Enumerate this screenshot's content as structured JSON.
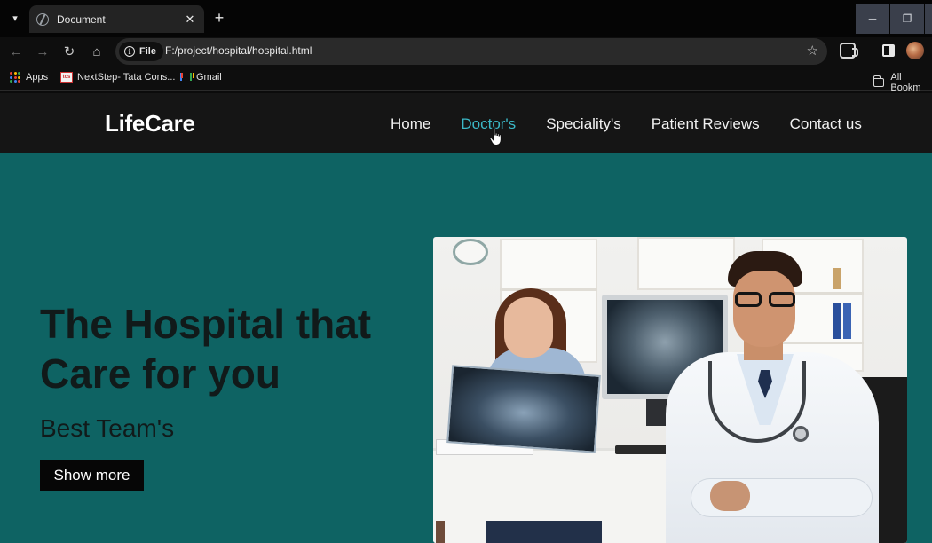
{
  "browser": {
    "tab_title": "Document",
    "tab_close": "✕",
    "new_tab": "+",
    "url_scheme_label": "File",
    "url": "F:/project/hospital/hospital.html",
    "window_min": "─",
    "window_restore": "❐"
  },
  "bookmarks": {
    "items": [
      {
        "label": "Apps",
        "icon": "apps-grid-icon"
      },
      {
        "label": "NextStep- Tata Cons...",
        "icon": "tcs-favicon"
      },
      {
        "label": "Gmail",
        "icon": "gmail-icon"
      }
    ],
    "all_bookmarks": "All Bookm"
  },
  "site": {
    "logo": "LifeCare",
    "nav": [
      {
        "label": "Home"
      },
      {
        "label": "Doctor's",
        "state": "hover"
      },
      {
        "label": "Speciality's"
      },
      {
        "label": "Patient Reviews"
      },
      {
        "label": "Contact us"
      }
    ],
    "hero": {
      "title": "The Hospital that Care for you",
      "subtitle": "Best Team's",
      "button": "Show more",
      "image": "doctors-xray-photo"
    }
  },
  "colors": {
    "page_bg": "#0e6363",
    "nav_bg": "#151515",
    "nav_active": "#3bb8c7",
    "button_bg": "#060606",
    "hero_text": "#111a1a"
  }
}
